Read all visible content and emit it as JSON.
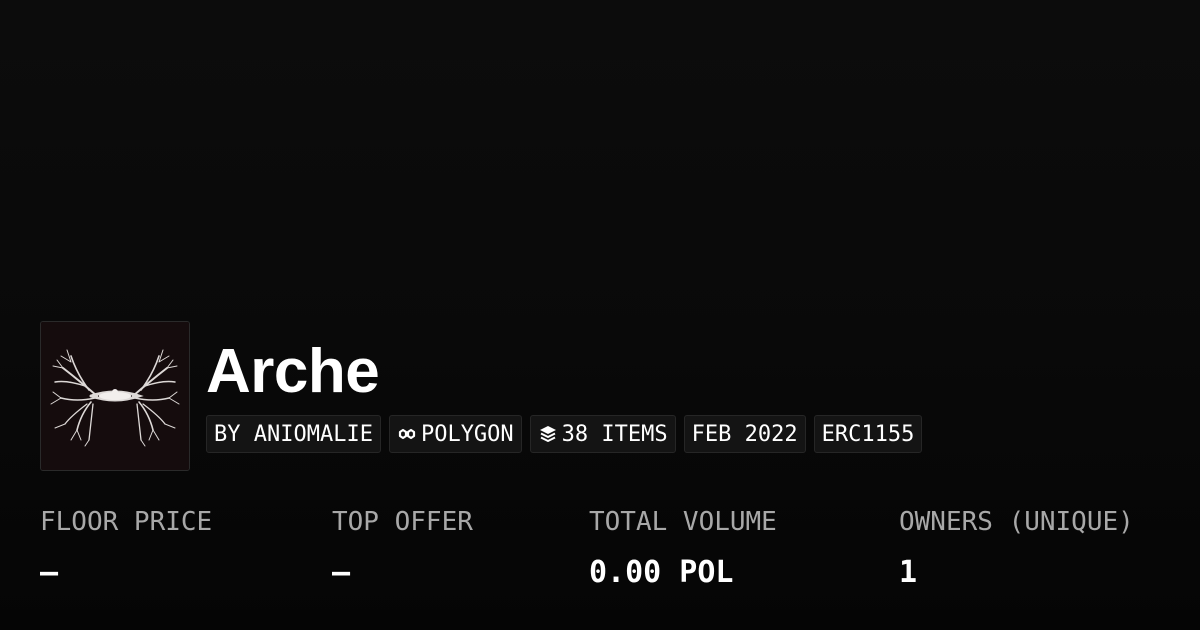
{
  "collection": {
    "name": "Arche",
    "avatar_alt": "white branching butterfly artwork",
    "tags": [
      {
        "label": "BY ANIOMALIE",
        "icon": ""
      },
      {
        "label": "POLYGON",
        "icon": "polygon-chain-icon"
      },
      {
        "label": "38 ITEMS",
        "icon": "layers-icon"
      },
      {
        "label": "FEB 2022",
        "icon": ""
      },
      {
        "label": "ERC1155",
        "icon": ""
      }
    ]
  },
  "stats": {
    "floor_price": {
      "label": "FLOOR PRICE",
      "value": "–"
    },
    "top_offer": {
      "label": "TOP OFFER",
      "value": "–"
    },
    "total_volume": {
      "label": "TOTAL VOLUME",
      "value": "0.00 POL"
    },
    "owners": {
      "label": "OWNERS (UNIQUE)",
      "value": "1"
    }
  },
  "colors": {
    "background": "#0a0a0a",
    "text": "#ffffff",
    "label": "#a8a8a8",
    "tag_background": "#141414",
    "tag_border": "#262626"
  }
}
